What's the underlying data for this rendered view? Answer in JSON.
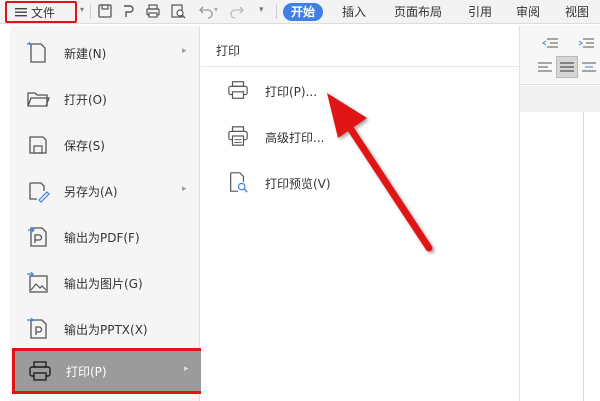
{
  "toolbar": {
    "file_label": "文件",
    "tabs": [
      {
        "label": "开始",
        "active": true
      },
      {
        "label": "插入"
      },
      {
        "label": "页面布局"
      },
      {
        "label": "引用"
      },
      {
        "label": "审阅"
      },
      {
        "label": "视图"
      }
    ],
    "icons": [
      "menu-icon",
      "save-icon",
      "print-preview-icon",
      "print-icon",
      "zoom-preview-icon",
      "undo-icon",
      "redo-icon",
      "dropdown-icon"
    ]
  },
  "menu": {
    "items": [
      {
        "label": "新建(N)",
        "icon": "new-document-icon",
        "has_arrow": true
      },
      {
        "label": "打开(O)",
        "icon": "folder-open-icon",
        "has_arrow": false
      },
      {
        "label": "保存(S)",
        "icon": "save-icon",
        "has_arrow": false
      },
      {
        "label": "另存为(A)",
        "icon": "save-as-icon",
        "has_arrow": true
      },
      {
        "label": "输出为PDF(F)",
        "icon": "export-pdf-icon",
        "has_arrow": false
      },
      {
        "label": "输出为图片(G)",
        "icon": "export-image-icon",
        "has_arrow": false
      },
      {
        "label": "输出为PPTX(X)",
        "icon": "export-pptx-icon",
        "has_arrow": false
      },
      {
        "label": "打印(P)",
        "icon": "print-icon",
        "has_arrow": true,
        "selected": true
      }
    ]
  },
  "submenu": {
    "title": "打印",
    "items": [
      {
        "label": "打印(P)...",
        "icon": "print-icon"
      },
      {
        "label": "高级打印...",
        "icon": "advanced-print-icon"
      },
      {
        "label": "打印预览(V)",
        "icon": "print-preview-icon"
      }
    ]
  },
  "colors": {
    "accent": "#3f7fe6",
    "highlight_border": "#e01414",
    "selected_bg": "#9b9b9b",
    "annotation_arrow": "#e01414"
  }
}
